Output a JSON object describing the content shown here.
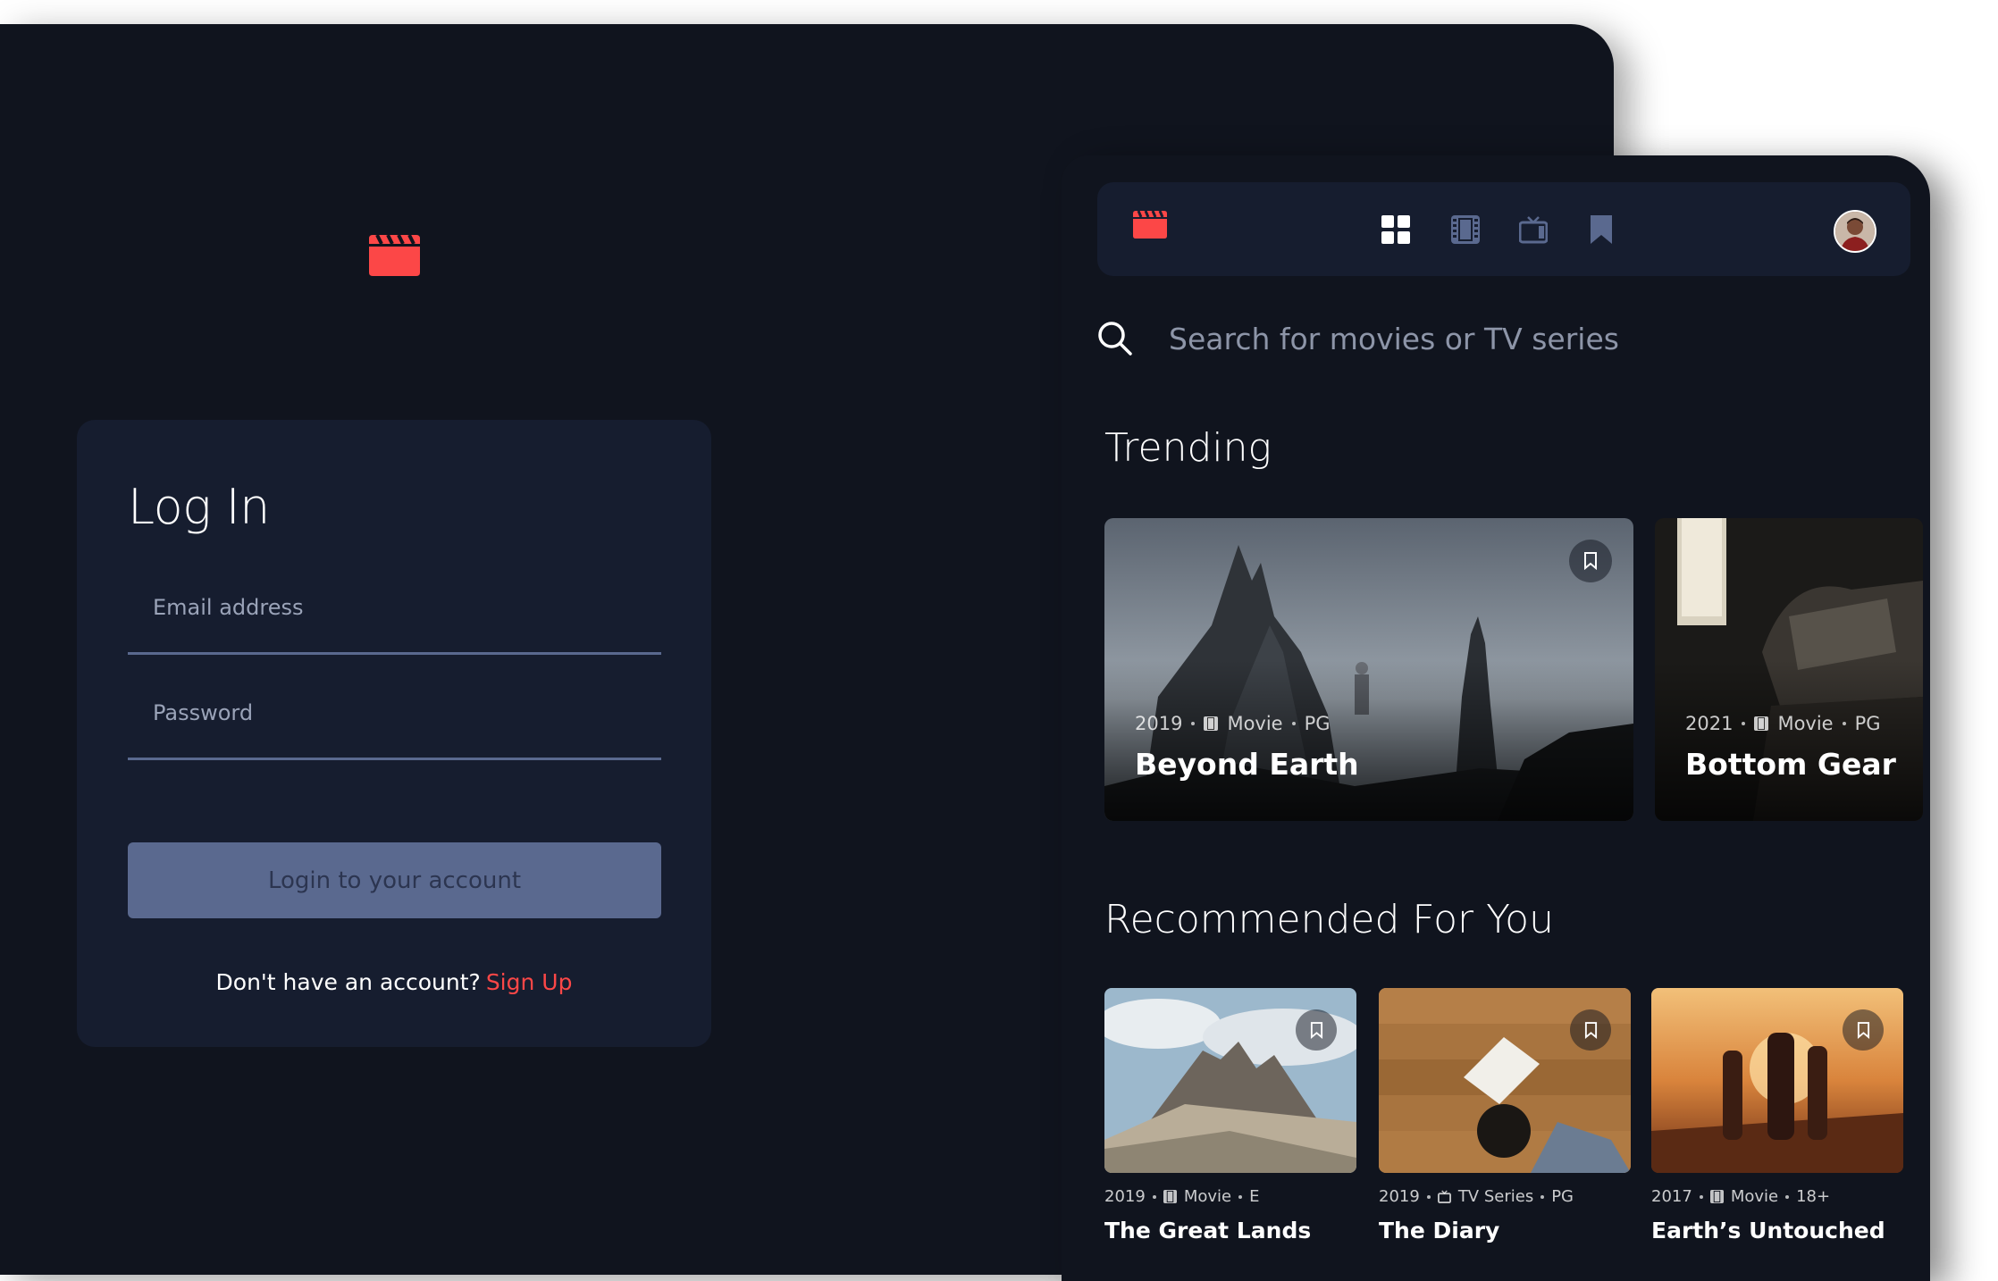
{
  "login": {
    "title": "Log In",
    "email_placeholder": "Email address",
    "password_placeholder": "Password",
    "login_button": "Login to your account",
    "signup_prompt": "Don't have an account?",
    "signup_link": "Sign Up"
  },
  "home": {
    "search_placeholder": "Search for movies or TV series",
    "trending_title": "Trending",
    "recommended_title": "Recommended For You",
    "trending": [
      {
        "year": "2019",
        "category": "Movie",
        "category_icon": "film-icon",
        "rating": "PG",
        "title": "Beyond Earth"
      },
      {
        "year": "2021",
        "category": "Movie",
        "category_icon": "film-icon",
        "rating": "PG",
        "title": "Bottom Gear"
      }
    ],
    "recommended": [
      {
        "year": "2019",
        "category": "Movie",
        "category_icon": "film-icon",
        "rating": "E",
        "title": "The Great Lands"
      },
      {
        "year": "2019",
        "category": "TV Series",
        "category_icon": "tv-icon",
        "rating": "PG",
        "title": "The Diary"
      },
      {
        "year": "2017",
        "category": "Movie",
        "category_icon": "film-icon",
        "rating": "18+",
        "title": "Earth’s Untouched"
      }
    ]
  },
  "nav": {
    "icons": [
      "clapperboard-logo-icon",
      "home-grid-icon",
      "film-icon",
      "tv-icon",
      "bookmark-icon"
    ]
  },
  "colors": {
    "background": "#10141e",
    "surface": "#161d2f",
    "accent": "#fc4747",
    "muted": "#5a698f",
    "text": "#ffffff"
  }
}
